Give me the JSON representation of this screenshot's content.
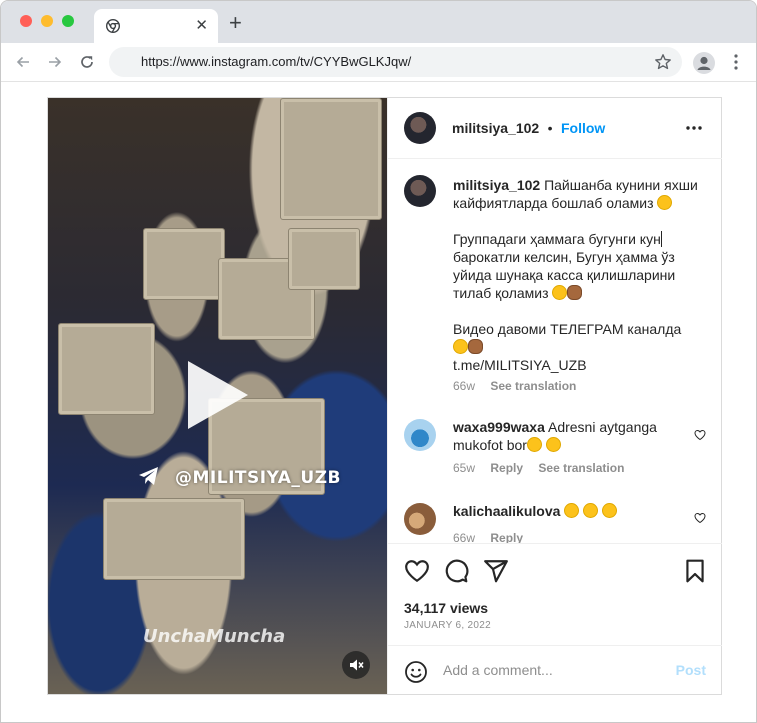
{
  "browser": {
    "tab_title": "",
    "url": "https://www.instagram.com/tv/CYYBwGLKJqw/",
    "new_tab_symbol": "+",
    "tab_close_symbol": "✕"
  },
  "post": {
    "header": {
      "username": "militsiya_102",
      "separator": "•",
      "follow_label": "Follow"
    },
    "media": {
      "watermark_channel": "@MILITSIYA_UZB",
      "watermark_brand": "UnchaMuncha"
    },
    "caption": {
      "username": "militsiya_102",
      "line1": "Пайшанба кунини яхши кайфиятларда бошлаб оламиз",
      "line2a": "Группадаги ҳаммага бугунги кун",
      "line2b": "барокатли келсин, Бугун ҳамма ўз уйида шунақа касса қилишларини тилаб қоламиз",
      "line3": "Видео давоми ТЕЛЕГРАМ каналда",
      "link": "t.me/MILITSIYA_UZB",
      "time": "66w",
      "translate_label": "See translation"
    },
    "comments": [
      {
        "username": "waxa999waxa",
        "text": "Adresni aytganga mukofot bor",
        "time": "65w",
        "reply_label": "Reply",
        "translate_label": "See translation"
      },
      {
        "username": "kalichaalikulova",
        "text": "",
        "time": "66w",
        "reply_label": "Reply"
      }
    ],
    "stats": {
      "views": "34,117 views",
      "date": "JANUARY 6, 2022"
    },
    "add_comment": {
      "placeholder": "Add a comment...",
      "post_label": "Post"
    }
  },
  "icons": {
    "accent": "#0095f6",
    "secondary_text": "#8e8e8e",
    "names": [
      "chrome-icon",
      "back-icon",
      "forward-icon",
      "reload-icon",
      "star-icon",
      "profile-icon",
      "kebab-menu-icon",
      "more-icon",
      "heart-icon",
      "comment-icon",
      "share-icon",
      "save-icon",
      "emoji-icon",
      "mute-icon",
      "play-icon",
      "telegram-icon"
    ]
  }
}
